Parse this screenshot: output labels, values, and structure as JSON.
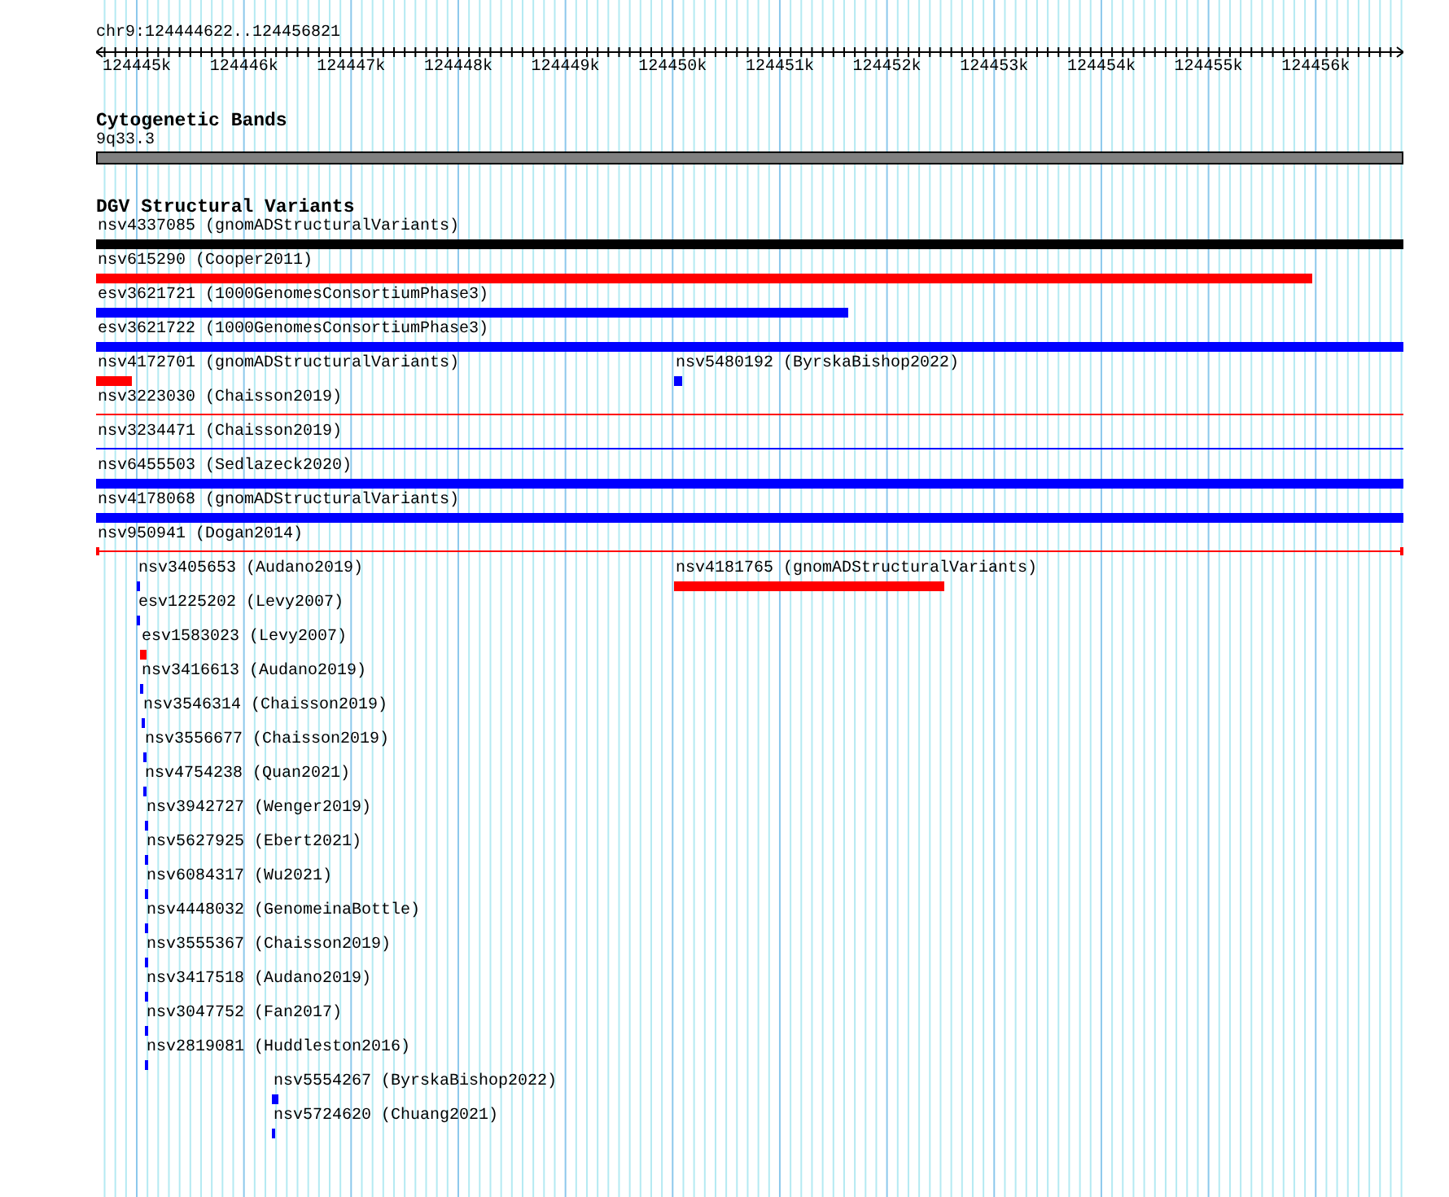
{
  "location": "chr9:124444622..124456821",
  "ruler": {
    "ticks": [
      "124445k",
      "124446k",
      "124447k",
      "124448k",
      "124449k",
      "124450k",
      "124451k",
      "124452k",
      "124453k",
      "124454k",
      "124455k",
      "124456k"
    ]
  },
  "tracks": [
    {
      "kind": "bands",
      "title": "Cytogenetic Bands",
      "features": [
        {
          "label": "9q33.3",
          "color": "#808080"
        }
      ]
    },
    {
      "kind": "variants",
      "title": "DGV Structural Variants",
      "rows": [
        {
          "features": [
            {
              "label": "nsv4337085 (gnomADStructuralVariants)",
              "color": "#000000",
              "kind": "thick"
            }
          ]
        },
        {
          "features": [
            {
              "label": "nsv615290 (Cooper2011)",
              "color": "#ff0000",
              "kind": "thick"
            }
          ]
        },
        {
          "features": [
            {
              "label": "esv3621721 (1000GenomesConsortiumPhase3)",
              "color": "#0000ff",
              "kind": "thick"
            }
          ]
        },
        {
          "features": [
            {
              "label": "esv3621722 (1000GenomesConsortiumPhase3)",
              "color": "#0000ff",
              "kind": "thick"
            }
          ]
        },
        {
          "features": [
            {
              "label": "nsv4172701 (gnomADStructuralVariants)",
              "color": "#ff0000",
              "kind": "thick"
            },
            {
              "label": "nsv5480192 (ByrskaBishop2022)",
              "color": "#0000ff",
              "kind": "thick"
            }
          ]
        },
        {
          "features": [
            {
              "label": "nsv3223030 (Chaisson2019)",
              "color": "#ff0000",
              "kind": "thin"
            }
          ]
        },
        {
          "features": [
            {
              "label": "nsv3234471 (Chaisson2019)",
              "color": "#0000ff",
              "kind": "thin"
            }
          ]
        },
        {
          "features": [
            {
              "label": "nsv6455503 (Sedlazeck2020)",
              "color": "#0000ff",
              "kind": "thick"
            }
          ]
        },
        {
          "features": [
            {
              "label": "nsv4178068 (gnomADStructuralVariants)",
              "color": "#0000ff",
              "kind": "thick"
            }
          ]
        },
        {
          "features": [
            {
              "label": "nsv950941 (Dogan2014)",
              "color": "#ff0000",
              "kind": "capped"
            }
          ]
        },
        {
          "features": [
            {
              "label": "nsv3405653 (Audano2019)",
              "color": "#0000ff",
              "kind": "thick"
            },
            {
              "label": "nsv4181765 (gnomADStructuralVariants)",
              "color": "#ff0000",
              "kind": "thick"
            }
          ]
        },
        {
          "features": [
            {
              "label": "esv1225202 (Levy2007)",
              "color": "#0000ff",
              "kind": "thick"
            }
          ]
        },
        {
          "features": [
            {
              "label": "esv1583023 (Levy2007)",
              "color": "#ff0000",
              "kind": "thick"
            }
          ]
        },
        {
          "features": [
            {
              "label": "nsv3416613 (Audano2019)",
              "color": "#0000ff",
              "kind": "thick"
            }
          ]
        },
        {
          "features": [
            {
              "label": "nsv3546314 (Chaisson2019)",
              "color": "#0000ff",
              "kind": "thick"
            }
          ]
        },
        {
          "features": [
            {
              "label": "nsv3556677 (Chaisson2019)",
              "color": "#0000ff",
              "kind": "thick"
            }
          ]
        },
        {
          "features": [
            {
              "label": "nsv4754238 (Quan2021)",
              "color": "#0000ff",
              "kind": "thick"
            }
          ]
        },
        {
          "features": [
            {
              "label": "nsv3942727 (Wenger2019)",
              "color": "#0000ff",
              "kind": "thick"
            }
          ]
        },
        {
          "features": [
            {
              "label": "nsv5627925 (Ebert2021)",
              "color": "#0000ff",
              "kind": "thick"
            }
          ]
        },
        {
          "features": [
            {
              "label": "nsv6084317 (Wu2021)",
              "color": "#0000ff",
              "kind": "thick"
            }
          ]
        },
        {
          "features": [
            {
              "label": "nsv4448032 (GenomeinaBottle)",
              "color": "#0000ff",
              "kind": "thick"
            }
          ]
        },
        {
          "features": [
            {
              "label": "nsv3555367 (Chaisson2019)",
              "color": "#0000ff",
              "kind": "thick"
            }
          ]
        },
        {
          "features": [
            {
              "label": "nsv3417518 (Audano2019)",
              "color": "#0000ff",
              "kind": "thick"
            }
          ]
        },
        {
          "features": [
            {
              "label": "nsv3047752 (Fan2017)",
              "color": "#0000ff",
              "kind": "thick"
            }
          ]
        },
        {
          "features": [
            {
              "label": "nsv2819081 (Huddleston2016)",
              "color": "#0000ff",
              "kind": "thick"
            }
          ]
        },
        {
          "features": [
            {
              "label": "nsv5554267 (ByrskaBishop2022)",
              "color": "#0000ff",
              "kind": "thick"
            }
          ]
        },
        {
          "features": [
            {
              "label": "nsv5724620 (Chuang2021)",
              "color": "#0000ff",
              "kind": "thick"
            }
          ]
        }
      ]
    }
  ]
}
